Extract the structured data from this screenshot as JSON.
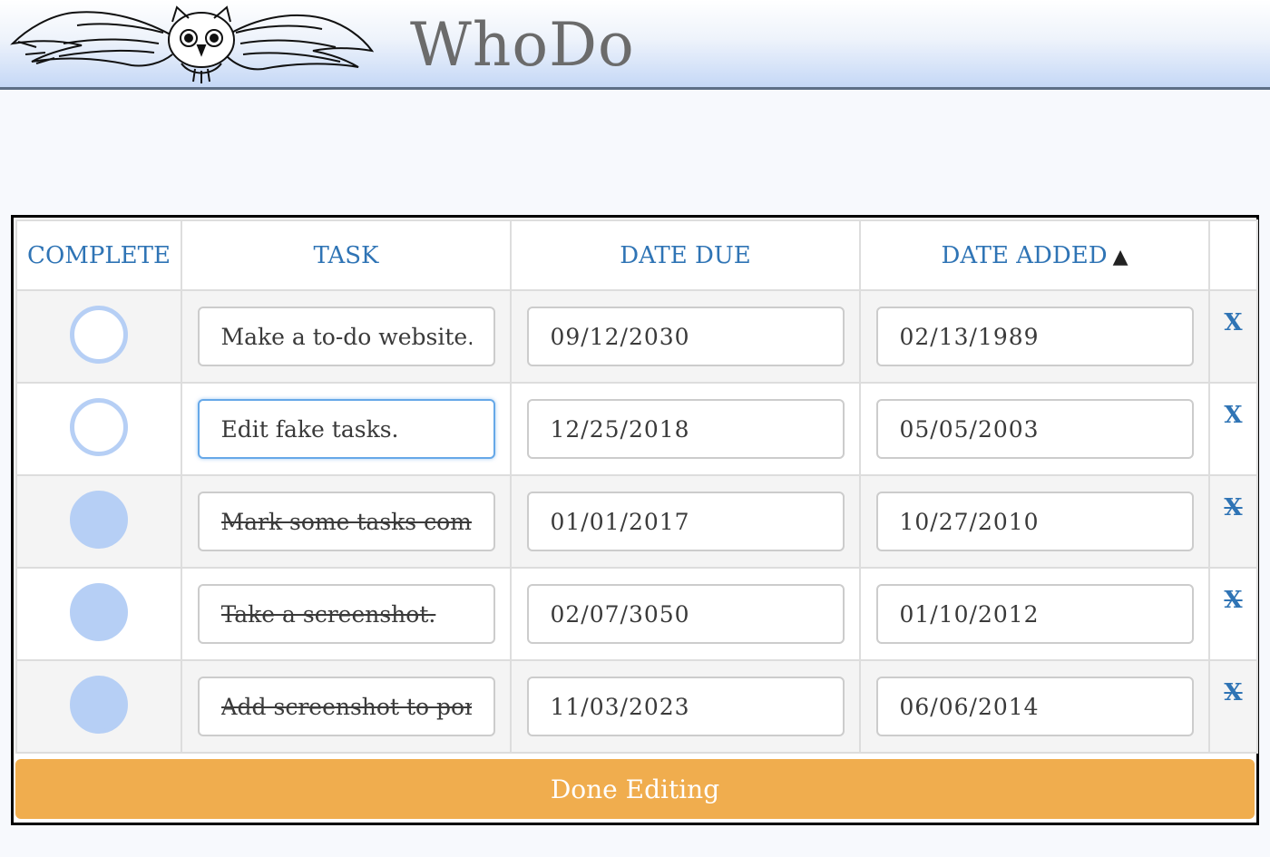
{
  "app": {
    "name": "WhoDo",
    "accent": "#2f74b5",
    "button_color": "#f0ad4e"
  },
  "table": {
    "headers": {
      "complete": "COMPLETE",
      "task": "TASK",
      "date_due": "DATE DUE",
      "date_added": "DATE ADDED",
      "date_added_sort": "▲"
    },
    "rows": [
      {
        "complete": false,
        "task": "Make a to-do website.",
        "date_due": "09/12/2030",
        "date_added": "02/13/1989",
        "delete": "X"
      },
      {
        "complete": false,
        "task": "Edit fake tasks.",
        "date_due": "12/25/2018",
        "date_added": "05/05/2003",
        "delete": "X"
      },
      {
        "complete": true,
        "task": "Mark some tasks comp",
        "date_due": "01/01/2017",
        "date_added": "10/27/2010",
        "delete": "X"
      },
      {
        "complete": true,
        "task": "Take a screenshot.",
        "date_due": "02/07/3050",
        "date_added": "01/10/2012",
        "delete": "X"
      },
      {
        "complete": true,
        "task": "Add screenshot to port",
        "date_due": "11/03/2023",
        "date_added": "06/06/2014",
        "delete": "X"
      }
    ]
  },
  "done_button": "Done Editing"
}
